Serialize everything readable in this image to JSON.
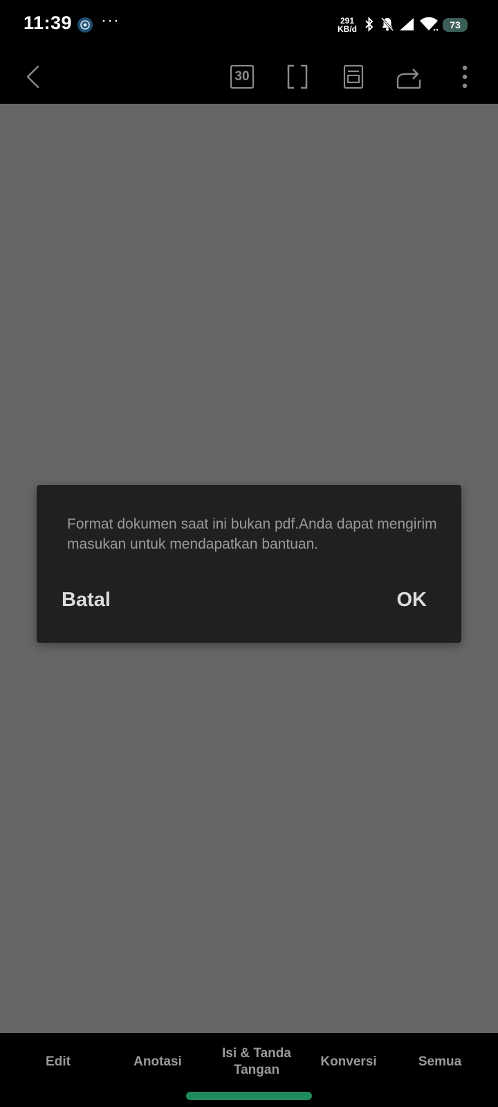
{
  "status_bar": {
    "time": "11:39",
    "more_indicator": "···",
    "net_speed_value": "291",
    "net_speed_unit": "KB/d",
    "battery_level": "73",
    "icons": [
      "chrome-notification-icon",
      "bluetooth-icon",
      "muted-bell-icon",
      "signal-icon",
      "wifi-icon",
      "battery-icon"
    ]
  },
  "toolbar": {
    "page_number": "30",
    "icons": [
      "back-icon",
      "page-number-icon",
      "fullscreen-icon",
      "reading-mode-icon",
      "share-icon",
      "more-options-icon"
    ]
  },
  "dialog": {
    "message": "Format dokumen saat ini bukan pdf.Anda dapat mengirim masukan untuk mendapatkan bantuan.",
    "cancel_label": "Batal",
    "ok_label": "OK"
  },
  "bottom_nav": {
    "items": [
      {
        "label": "Edit"
      },
      {
        "label": "Anotasi"
      },
      {
        "label": "Isi & Tanda Tangan"
      },
      {
        "label": "Konversi"
      },
      {
        "label": "Semua"
      }
    ]
  },
  "colors": {
    "background_dim": "#666666",
    "dialog_bg": "#202020",
    "home_indicator": "#1f8a5c",
    "battery_bg": "#3b5e58"
  }
}
